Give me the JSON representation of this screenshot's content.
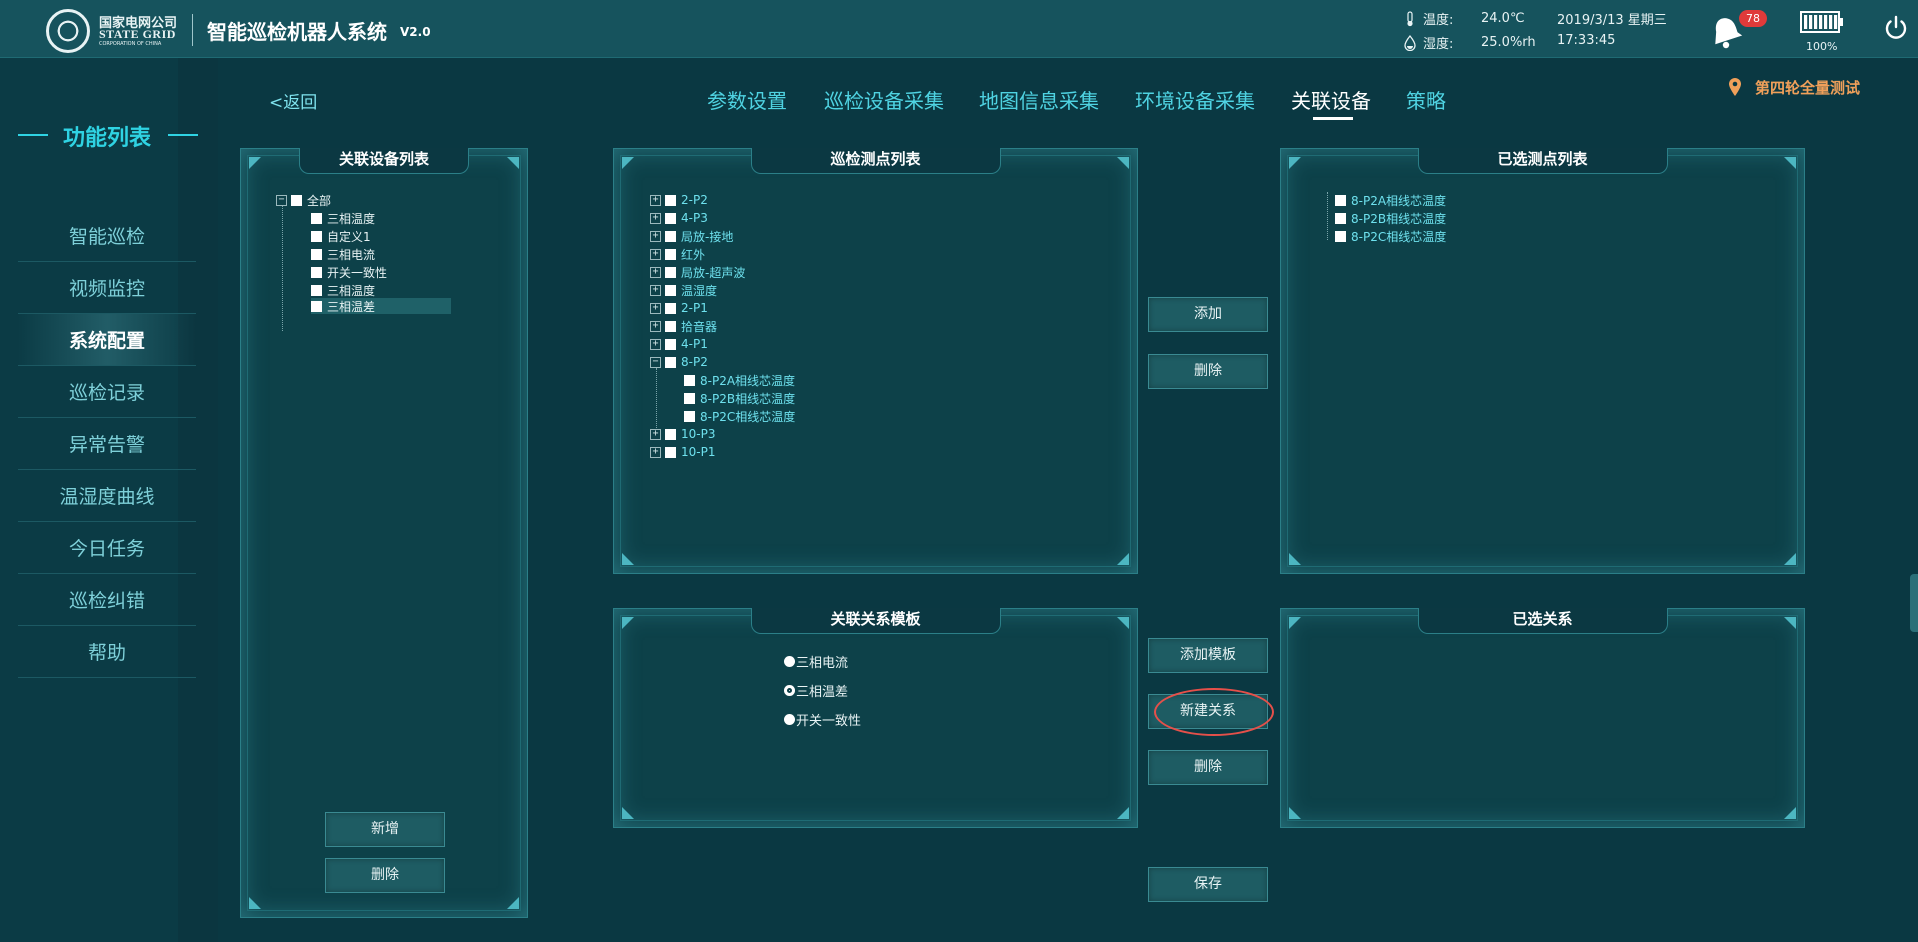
{
  "header": {
    "logo_cn": "国家电网公司",
    "logo_en": "STATE GRID",
    "logo_sub": "CORPORATION OF CHINA",
    "title": "智能巡检机器人系统",
    "version": "V2.0",
    "temperature_label": "温度:",
    "temperature_value": "24.0℃",
    "humidity_label": "湿度:",
    "humidity_value": "25.0%rh",
    "date": "2019/3/13 星期三",
    "time": "17:33:45",
    "alarm_count": "78",
    "battery_level": "100%",
    "battery_fraction": 1.0
  },
  "sidebar": {
    "title": "功能列表",
    "items": [
      {
        "label": "智能巡检"
      },
      {
        "label": "视频监控"
      },
      {
        "label": "系统配置"
      },
      {
        "label": "巡检记录"
      },
      {
        "label": "异常告警"
      },
      {
        "label": "温湿度曲线"
      },
      {
        "label": "今日任务"
      },
      {
        "label": "巡检纠错"
      },
      {
        "label": "帮助"
      }
    ],
    "active_index": 2
  },
  "nav": {
    "back": "<返回",
    "tabs": [
      {
        "label": "参数设置"
      },
      {
        "label": "巡检设备采集"
      },
      {
        "label": "地图信息采集"
      },
      {
        "label": "环境设备采集"
      },
      {
        "label": "关联设备"
      },
      {
        "label": "策略"
      }
    ],
    "active_index": 4,
    "project": "第四轮全量测试"
  },
  "device_panel": {
    "title": "关联设备列表",
    "root": "全部",
    "items": [
      "三相温度",
      "自定义1",
      "三相电流",
      "开关一致性",
      "三相温度",
      "三相温差"
    ],
    "selected_index": 5,
    "add_button": "新增",
    "delete_button": "删除"
  },
  "points_panel": {
    "title": "巡检测点列表",
    "items": [
      {
        "label": "2-P2",
        "expanded": false
      },
      {
        "label": "4-P3",
        "expanded": false
      },
      {
        "label": "局放-接地",
        "expanded": false
      },
      {
        "label": "红外",
        "expanded": false
      },
      {
        "label": "局放-超声波",
        "expanded": false
      },
      {
        "label": "温湿度",
        "expanded": false
      },
      {
        "label": "2-P1",
        "expanded": false
      },
      {
        "label": "拾音器",
        "expanded": false
      },
      {
        "label": "4-P1",
        "expanded": false
      },
      {
        "label": "8-P2",
        "expanded": true,
        "children": [
          "8-P2A相线芯温度",
          "8-P2B相线芯温度",
          "8-P2C相线芯温度"
        ]
      },
      {
        "label": "10-P3",
        "expanded": false
      },
      {
        "label": "10-P1",
        "expanded": false
      }
    ]
  },
  "middle_buttons": {
    "add": "添加",
    "delete_top": "删除",
    "add_template": "添加模板",
    "new_relation": "新建关系",
    "delete_bottom": "删除",
    "save": "保存"
  },
  "selected_points_panel": {
    "title": "已选测点列表",
    "items": [
      "8-P2A相线芯温度",
      "8-P2B相线芯温度",
      "8-P2C相线芯温度"
    ]
  },
  "template_panel": {
    "title": "关联关系模板",
    "options": [
      {
        "label": "三相电流",
        "checked": false
      },
      {
        "label": "三相温差",
        "checked": true
      },
      {
        "label": "开关一致性",
        "checked": false
      }
    ]
  },
  "relations_panel": {
    "title": "已选关系"
  },
  "colors": {
    "accent": "#2fd3e3",
    "alarm": "#e03a3a",
    "project": "#f0a05a",
    "highlight": "#e5504a"
  }
}
